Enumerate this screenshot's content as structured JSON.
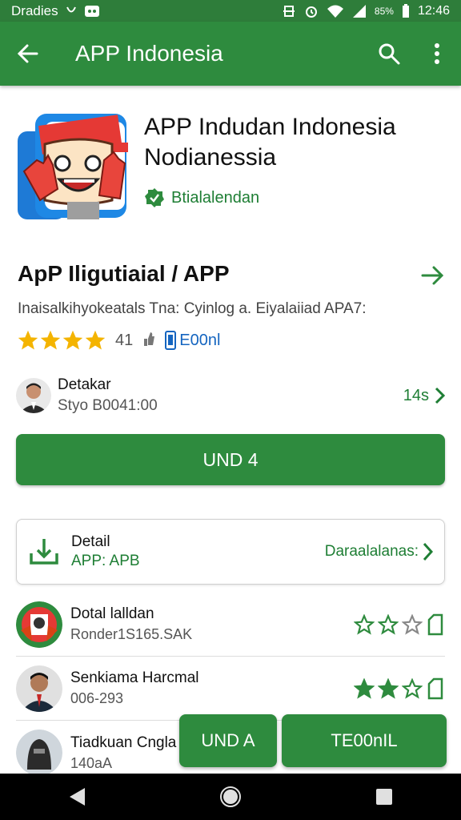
{
  "status_bar": {
    "left_text": "Dradies",
    "icons": [
      "carrier-glyph-icon",
      "notification-icon",
      "sync-icon",
      "alarm-icon",
      "wifi-icon",
      "signal-icon"
    ],
    "battery": "85%",
    "time": "12:46"
  },
  "app_bar": {
    "title": "APP Indonesia",
    "back_icon": "arrow-back-icon",
    "search_icon": "search-icon",
    "menu_icon": "more-vert-icon"
  },
  "app_header": {
    "name_line1": "APP Indudan Indonesia",
    "name_line2": "Nodianessia",
    "developer": "Btialalendan",
    "developer_icon": "verified-badge-icon"
  },
  "section": {
    "title": "ApP Iligutiaial / APP",
    "arrow_icon": "arrow-forward-icon",
    "description": "Inaisalkihyokeatals Tna: Cyinlog a. Eiyalaiiad APA7:",
    "rating_stars": 4,
    "rating_count": "41",
    "badge_text": "E00nl",
    "colors": {
      "star": "#f4b400",
      "accent": "#2e8b3e",
      "link": "#1e7e34"
    }
  },
  "developer_row": {
    "title": "Detakar",
    "subtitle": "Styo B0041:00",
    "right_text": "14s"
  },
  "install_button": {
    "label": "UND 4"
  },
  "detail_card": {
    "title": "Detail",
    "subtitle": "APP: APB",
    "right_text": "Daraalalanas:"
  },
  "reviews": [
    {
      "name": "Dotal lalldan",
      "meta": "Ronder1S165.SAK",
      "stars": 0
    },
    {
      "name": "Senkiama Harcmal",
      "meta": "006-293",
      "stars": 2
    },
    {
      "name": "Tiadkuan Cngla",
      "meta": "140aA",
      "stars": 0
    }
  ],
  "bottom_buttons": {
    "left_label": "UND A",
    "right_label": "TE00nIL"
  },
  "nav_bar": {
    "back_icon": "nav-back-icon",
    "home_icon": "nav-home-icon",
    "recents_icon": "nav-recents-icon"
  }
}
